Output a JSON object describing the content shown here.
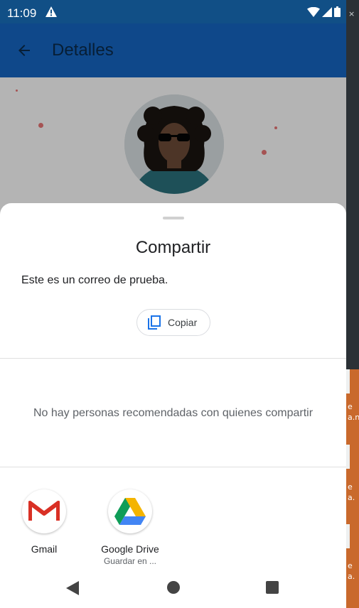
{
  "status_bar": {
    "time": "11:09"
  },
  "app_bar": {
    "title": "Detalles"
  },
  "share_sheet": {
    "title": "Compartir",
    "shared_text": "Este es un correo de prueba.",
    "copy_label": "Copiar",
    "no_recommendations": "No hay personas recomendadas con quienes compartir",
    "targets": [
      {
        "name": "Gmail",
        "subtitle": ""
      },
      {
        "name": "Google Drive",
        "subtitle": "Guardar en ..."
      }
    ]
  },
  "colors": {
    "status_bar": "#114f86",
    "app_bar": "#1565c0",
    "copy_icon": "#1a73e8",
    "desktop_bg": "#c9692c"
  },
  "icons": {
    "back": "arrow-left-icon",
    "copy": "copy-icon",
    "nav_back": "triangle-back-icon",
    "nav_home": "circle-home-icon",
    "nav_recents": "square-recents-icon"
  },
  "desktop_fragments": [
    "e",
    "a.n",
    "e",
    "a.",
    "e",
    "a."
  ]
}
